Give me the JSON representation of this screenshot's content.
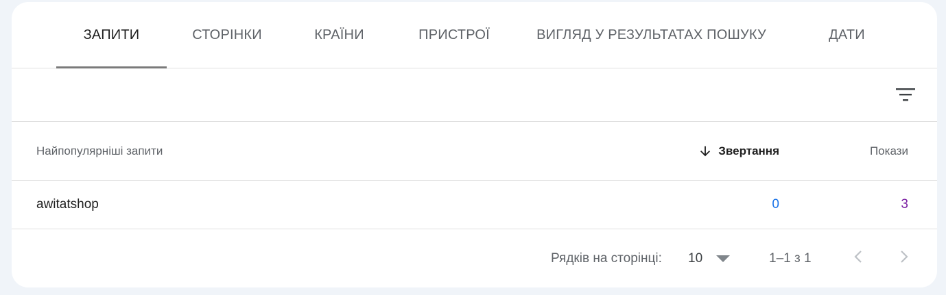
{
  "tabs": [
    {
      "label": "ЗАПИТИ",
      "active": true
    },
    {
      "label": "СТОРІНКИ",
      "active": false
    },
    {
      "label": "КРАЇНИ",
      "active": false
    },
    {
      "label": "ПРИСТРОЇ",
      "active": false
    },
    {
      "label": "ВИГЛЯД У РЕЗУЛЬТАТАХ ПОШУКУ",
      "active": false
    },
    {
      "label": "ДАТИ",
      "active": false
    }
  ],
  "filter": {
    "icon": "filter-list-icon"
  },
  "table": {
    "columns": {
      "query": "Найпопулярніші запити",
      "clicks": "Звертання",
      "impressions": "Покази"
    },
    "sort_icon": "arrow-down-icon",
    "rows": [
      {
        "query": "awitatshop",
        "clicks": "0",
        "impressions": "3"
      }
    ]
  },
  "pagination": {
    "rows_per_page_label": "Рядків на сторінці:",
    "rows_per_page_value": "10",
    "range": "1–1 з 1",
    "prev_icon": "chevron-left-icon",
    "next_icon": "chevron-right-icon"
  },
  "colors": {
    "clicks": "#1a73e8",
    "impressions": "#7b1fa2",
    "active_tab_indicator": "#7a7a7a"
  }
}
